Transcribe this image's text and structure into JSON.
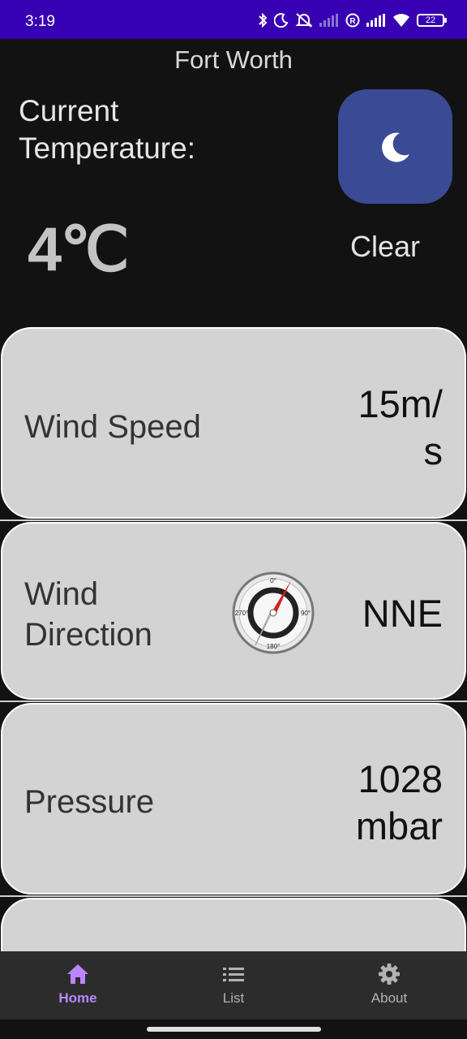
{
  "status_bar": {
    "time": "3:19",
    "battery": "22",
    "icons": [
      "bluetooth-icon",
      "moon-dnd-icon",
      "silent-icon",
      "signal-icon",
      "registered-icon",
      "signal-icon",
      "wifi-icon",
      "battery-icon"
    ]
  },
  "header": {
    "city": "Fort Worth",
    "current_label": "Current Temperature:",
    "temperature": "4℃",
    "condition": "Clear",
    "condition_icon": "moon-icon",
    "icon_bg_color": "#3b4a94"
  },
  "cards": {
    "wind_speed": {
      "label": "Wind Speed",
      "value_line1": "15m/",
      "value_line2": "s"
    },
    "wind_direction": {
      "label_line1": "Wind",
      "label_line2": "Direction",
      "value": "NNE",
      "compass_icon": "compass-icon",
      "compass_marks": {
        "n": "0°",
        "e": "90°",
        "s": "180°",
        "w": "270°"
      }
    },
    "pressure": {
      "label": "Pressure",
      "value_line1": "1028",
      "value_line2": "mbar"
    }
  },
  "nav": {
    "items": [
      {
        "label": "Home",
        "icon": "home-icon",
        "active": true
      },
      {
        "label": "List",
        "icon": "list-icon",
        "active": false
      },
      {
        "label": "About",
        "icon": "gear-icon",
        "active": false
      }
    ]
  },
  "colors": {
    "status_bar": "#3700b3",
    "background": "#121212",
    "card": "#d3d3d3",
    "nav_active": "#bb86fc",
    "nav_bar": "#2c2c2c"
  }
}
